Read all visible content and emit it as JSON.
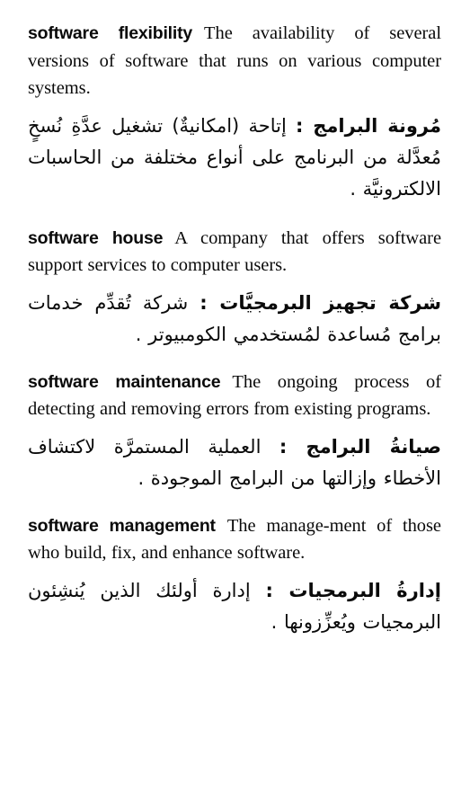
{
  "page": {
    "type": "bilingual-dictionary-page",
    "language_pair": "English-Arabic",
    "background_color": "#ffffff",
    "text_color": "#0a0a0a"
  },
  "entries": [
    {
      "headword": "software flexibility",
      "definition_en": "The availability of several versions of software that runs on various computer systems.",
      "headword_ar": "مُرونة البرامج :",
      "definition_ar": "إتاحة (امكانيةٌ) تشغيل عدَّةِ نُسخٍ مُعدَّلة من البرنامج على أنواع مختلفة من الحاسبات الالكترونيَّة ."
    },
    {
      "headword": "software house",
      "definition_en": "A company that offers software support services to computer users.",
      "headword_ar": "شركة تجهيز البرمجيَّات :",
      "definition_ar": "شركة تُقدِّم خدمات برامج مُساعدة لمُستخدمي الكومبيوتر ."
    },
    {
      "headword": "software maintenance",
      "definition_en": "The ongoing process of detecting and removing errors from existing programs.",
      "headword_ar": "صيانةُ البرامج :",
      "definition_ar": "العملية المستمرَّة لاكتشاف الأخطاء وإزالتها من البرامج الموجودة ."
    },
    {
      "headword": "software management",
      "definition_en": "The manage‐ment of those who build, fix, and enhance software.",
      "headword_ar": "إدارةُ البرمجيات :",
      "definition_ar": "إدارة أولئك الذين يُنشِئون البرمجيات ويُعزِّزونها ."
    }
  ]
}
